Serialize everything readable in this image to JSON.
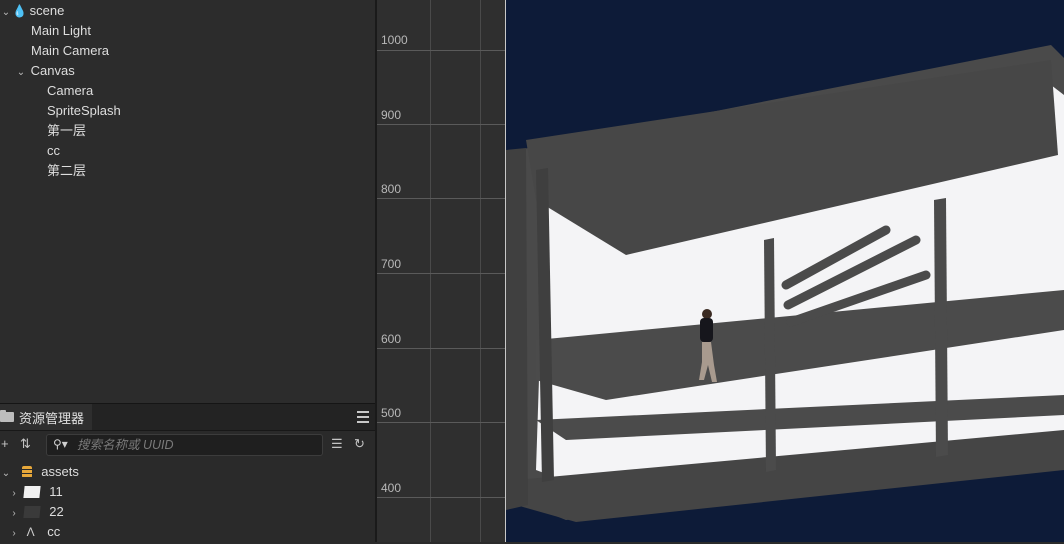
{
  "hierarchy": {
    "root": "scene",
    "items": [
      {
        "label": "Main Light"
      },
      {
        "label": "Main Camera"
      },
      {
        "label": "Canvas"
      },
      {
        "label": "Camera"
      },
      {
        "label": "SpriteSplash"
      },
      {
        "label": "第一层"
      },
      {
        "label": "cc"
      },
      {
        "label": "第二层"
      }
    ]
  },
  "assets_panel": {
    "tab_label": "资源管理器",
    "search_placeholder": "搜索名称或 UUID",
    "root": "assets",
    "items": [
      {
        "label": "11",
        "icon": "image-icon"
      },
      {
        "label": "22",
        "icon": "image-icon"
      },
      {
        "label": "cc",
        "icon": "skeleton-icon"
      }
    ]
  },
  "scene_view": {
    "ruler_labels": [
      "1000",
      "900",
      "800",
      "700",
      "600",
      "500",
      "400"
    ],
    "background_color": "#0d1b38",
    "accent_color": "#f0a030"
  }
}
